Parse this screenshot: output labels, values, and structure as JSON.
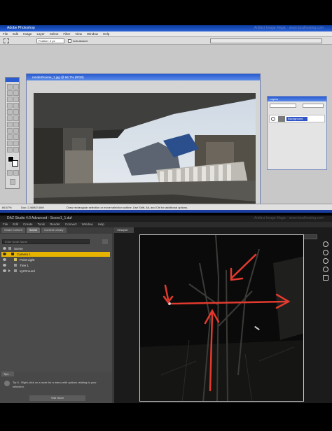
{
  "photoshop": {
    "title": "Adobe Photoshop",
    "watermark": "Artifact Image Magic · www.localhosting.com",
    "menu": [
      "File",
      "Edit",
      "Image",
      "Layer",
      "Select",
      "Filter",
      "View",
      "Window",
      "Help"
    ],
    "options": {
      "feather_label": "Feather: 0 px",
      "antialiased_label": "Anti-aliased"
    },
    "document_title": "render0scene_1.jpg @ 66.7% (RGB)",
    "layers_panel": {
      "title": "Layers",
      "layer_name": "Background"
    },
    "status": {
      "zoom": "66.67%",
      "doc_size": "Doc: 2.46M/2.46M",
      "hint": "Draw rectangular selection or move selection outline. Use Shift, Alt, and Ctrl for additional options."
    }
  },
  "daz": {
    "title": "DAZ Studio 4.0 Advanced - Scene1_1.duf",
    "watermark": "Artifact Image Magic · www.localhosting.com",
    "menu": [
      "File",
      "Edit",
      "Create",
      "Tools",
      "Render",
      "Connect",
      "Window",
      "Help"
    ],
    "tabs": [
      "Smart Content",
      "Scene",
      "Content Library"
    ],
    "active_tab": "Scene",
    "filter_placeholder": "Enter Node Name",
    "scene_rows": [
      {
        "label": "Scene",
        "selected": false
      },
      {
        "label": "Camera 1",
        "selected": true
      },
      {
        "label": "Point Light",
        "selected": false
      },
      {
        "label": "Tree 1",
        "selected": false
      },
      {
        "label": "xyzGround",
        "selected": false
      }
    ],
    "tips": {
      "tab": "Tips",
      "text": "Tip 5 - Right-click on a node for a menu with options relating to your selection.",
      "button": "Visit Store"
    },
    "viewport": {
      "tab": "Viewport",
      "camera": "Camera 1"
    }
  },
  "colors": {
    "ps_bg": "#c8c8c8",
    "ps_title": "#0b3a9c",
    "daz_bg": "#3a3a3a",
    "daz_selected": "#e6b400",
    "annotation_red": "#e23a2e"
  }
}
